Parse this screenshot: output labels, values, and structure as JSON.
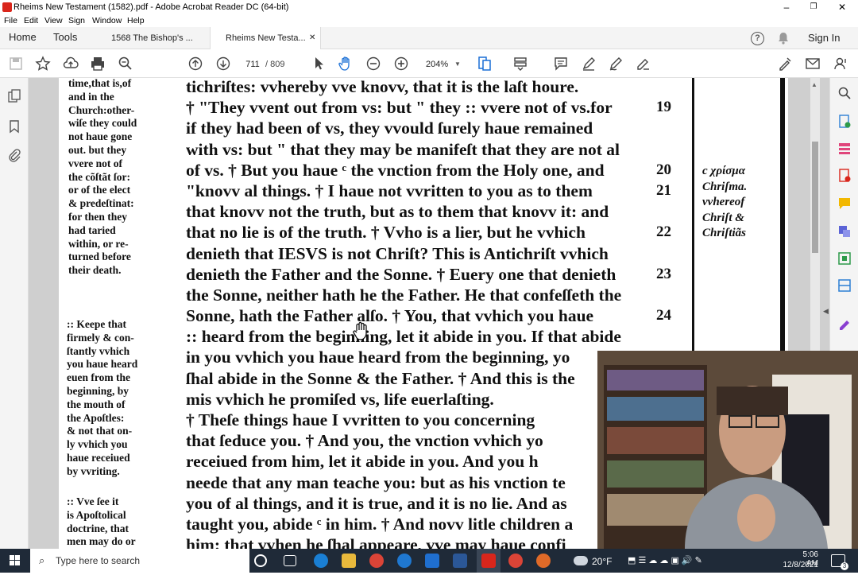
{
  "window": {
    "title": "Rheims New Testament (1582).pdf - Adobe Acrobat Reader DC (64-bit)",
    "minimize": "–",
    "maximize": "❐",
    "close": "✕"
  },
  "menu": [
    "File",
    "Edit",
    "View",
    "Sign",
    "Window",
    "Help"
  ],
  "tabs": {
    "home": "Home",
    "tools": "Tools",
    "doc1": "1568 The Bishop's ...",
    "doc2": "Rheims New Testa...",
    "doc2_close": "✕",
    "sign_in": "Sign In"
  },
  "toolbar": {
    "page_current": "711",
    "page_total": "/ 809",
    "zoom": "204%"
  },
  "document": {
    "left_notes": [
      "time,that is,of",
      "and in the",
      "Church:other-",
      "wiſe they could",
      "not haue gone",
      "out. but they",
      "vvere not of",
      "the cõſtãt ſor:",
      "or of the elect",
      "& predeſtinat:",
      "for then they",
      "had taried",
      "within, or re-",
      "turned before",
      "their death."
    ],
    "left_notes_2": [
      ":: Keepe that",
      "firmely & con-",
      "ſtantly vvhich",
      "you haue heard",
      "euen from the",
      "beginning, by",
      "the mouth of",
      "the Apoſtles:",
      "& not that on-",
      "ly vvhich you",
      "haue receiued",
      "by vvriting."
    ],
    "left_notes_3": [
      ":: Vve ſee it",
      "is Apoſtolical",
      "doctrine, that",
      "men may do or"
    ],
    "body_lines": [
      "tichriſtes: vvhereby vve knovv, that it is the laſt houre.",
      "† \"They vvent out from vs: but \" they :: vvere not of vs.for",
      "if they had been of vs, they vvould ſurely haue remained",
      "with vs: but \" that they may be manifeſt that they are not al",
      "of vs. † But you haue ᶜ the vnction from the Holy one, and",
      "\"knovv al things. † I haue not vvritten to you as to them",
      "that knovv not the truth, but as to them that knovv it: and",
      "that no lie is of the truth. † Vvho is a lier, but he vvhich",
      "denieth that IESVS is not Chriſt? This is Antichriſt vvhich",
      "denieth the Father and the Sonne. † Euery one that denieth",
      "the Sonne, neither hath he the Father. He that confeſſeth the",
      "Sonne, hath the Father alſo. † You, that vvhich you haue",
      ":: heard from the beginning, let it abide in you. If that abide",
      "in you vvhich you haue heard from the beginning, yo",
      "ſhal abide in the Sonne & the Father. † And this is the",
      "mis vvhich he promiſed vs, life euerlaſting.",
      "   † Theſe things haue I vvritten to you concerning",
      "that ſeduce you. † And you, the vnction vvhich yo",
      "receiued from him, let it abide in you. And you h",
      "neede that any man teache you: but as his vnction te",
      "you of al things, and it is true, and it is no lie. And as",
      "taught you, abide ᶜ in him. † And novv litle children a",
      "him: that vvhen he ſhal appeare, vve may haue confi"
    ],
    "verse_numbers": [
      "19",
      "20",
      "21",
      "22",
      "23",
      "24"
    ],
    "right_note": [
      "c χρίσμα",
      "Chriſma.",
      "vvhereof",
      "Chriſt &",
      "Chriſtiãs"
    ]
  },
  "taskbar": {
    "search_placeholder": "Type here to search",
    "weather": "20°F",
    "time": "5:06 AM",
    "date": "12/8/2021",
    "notifications": "3"
  }
}
